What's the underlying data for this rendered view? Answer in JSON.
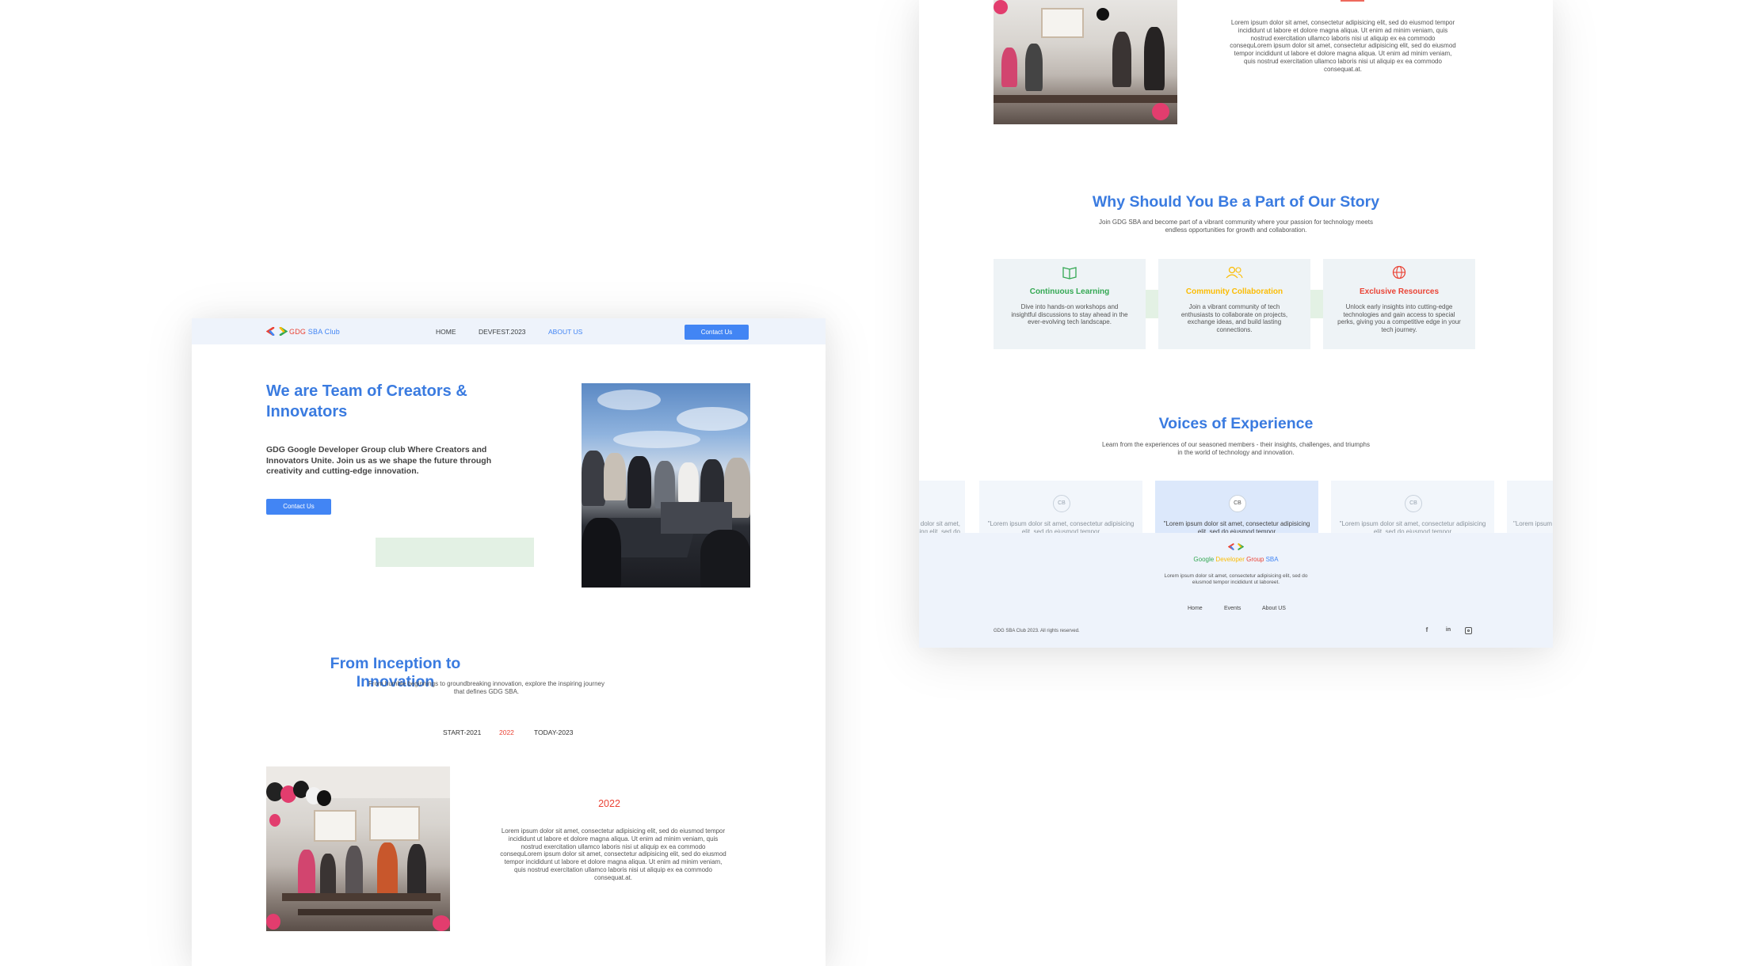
{
  "left": {
    "nav": {
      "brand_gdg": "GDG",
      "brand_rest": " SBA Club",
      "links": [
        "HOME",
        "DEVFEST.2023",
        "ABOUT US"
      ],
      "contact": "Contact Us"
    },
    "hero": {
      "title": "We are Team of Creators & Innovators",
      "text": "GDG Google Developer Group  club Where Creators and Innovators Unite. Join us as we shape the future through creativity and cutting-edge innovation.",
      "button": "Contact Us"
    },
    "journey": {
      "title": "From Inception to Innovation",
      "subtitle": "From humble beginnings to groundbreaking innovation, explore the inspiring journey that defines GDG SBA.",
      "tabs": [
        "START-2021",
        "2022",
        "TODAY-2023"
      ],
      "year": "2022",
      "text": "Lorem ipsum dolor sit amet, consectetur adipisicing elit, sed do eiusmod tempor incididunt ut labore et dolore magna aliqua. Ut enim ad minim veniam, quis nostrud exercitation ullamco laboris nisi ut aliquip ex ea commodo consequLorem ipsum dolor sit amet, consectetur adipisicing elit, sed do eiusmod tempor incididunt ut labore et dolore magna aliqua. Ut enim ad minim veniam, quis nostrud exercitation ullamco laboris nisi ut aliquip ex ea commodo consequat.at."
    }
  },
  "right": {
    "top_text": "Lorem ipsum dolor sit amet, consectetur adipisicing elit, sed do eiusmod tempor incididunt ut labore et dolore magna aliqua. Ut enim ad minim veniam, quis nostrud exercitation ullamco laboris nisi ut aliquip ex ea commodo consequLorem ipsum dolor sit amet, consectetur adipisicing elit, sed do eiusmod tempor incididunt ut labore et dolore magna aliqua. Ut enim ad minim veniam, quis nostrud exercitation ullamco laboris nisi ut aliquip ex ea commodo consequat.at.",
    "why": {
      "title": "Why Should You Be a Part of Our Story",
      "subtitle": "Join GDG SBA and become part of a vibrant community where your passion for technology meets endless opportunities for growth and collaboration.",
      "cards": [
        {
          "icon": "book-icon",
          "title": "Continuous Learning",
          "color": "#34a853",
          "text": "Dive into hands-on workshops and insightful discussions to stay ahead in the ever-evolving tech landscape."
        },
        {
          "icon": "users-icon",
          "title": "Community Collaboration",
          "color": "#fbbc04",
          "text": "Join a vibrant community of tech enthusiasts to collaborate on projects, exchange ideas, and build lasting connections."
        },
        {
          "icon": "globe-icon",
          "title": "Exclusive Resources",
          "color": "#ea4335",
          "text": "Unlock early insights into cutting-edge technologies and gain access to special perks, giving you a competitive edge in your tech journey."
        }
      ]
    },
    "voices": {
      "title": "Voices of Experience",
      "subtitle": "Learn from the experiences of our seasoned members - their insights, challenges, and triumphs in the world of technology and innovation.",
      "cards": [
        {
          "avatar": "",
          "quote": "\"Lorem ipsum dolor sit amet, consectetur adipisicing elit, sed do eiusmod tempor"
        },
        {
          "avatar": "CB",
          "quote": "\"Lorem ipsum dolor sit amet, consectetur adipisicing elit, sed do eiusmod tempor"
        },
        {
          "avatar": "CB",
          "quote": "\"Lorem ipsum dolor sit amet, consectetur adipisicing elit, sed do eiusmod tempor"
        },
        {
          "avatar": "CB",
          "quote": "\"Lorem ipsum dolor sit amet, consectetur adipisicing elit, sed do eiusmod tempor"
        },
        {
          "avatar": "",
          "quote": "\"Lorem ipsum dolor sit amet, consectetur"
        }
      ]
    },
    "footer": {
      "brand_google": "Google",
      "brand_developer": " Developer",
      "brand_group": " Group",
      "brand_sba": " SBA",
      "text": "Lorem ipsum dolor sit amet, consectetur adipisicing elit, sed do eiusmod tempor incididunt ut laboreet.",
      "links": [
        "Home",
        "Events",
        "About US"
      ],
      "copyright": "GDG SBA Club 2023. All rights reserved.",
      "socials": [
        "facebook-icon",
        "linkedin-icon",
        "instagram-icon"
      ]
    }
  }
}
